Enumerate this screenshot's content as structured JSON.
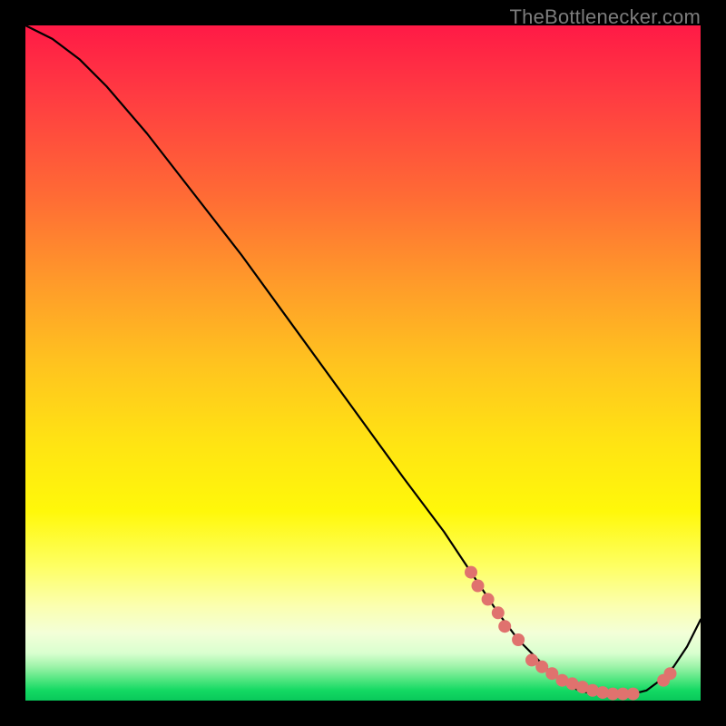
{
  "watermark": "TheBottlenecker.com",
  "colors": {
    "dot": "#e0726e",
    "line": "#000000"
  },
  "chart_data": {
    "type": "line",
    "title": "",
    "xlabel": "",
    "ylabel": "",
    "xlim": [
      0,
      100
    ],
    "ylim": [
      0,
      100
    ],
    "grid": false,
    "legend": false,
    "series": [
      {
        "name": "bottleneck-curve",
        "x": [
          0,
          4,
          8,
          12,
          18,
          25,
          32,
          40,
          48,
          56,
          62,
          66,
          70,
          73,
          76,
          78,
          80,
          82,
          84,
          86,
          88,
          90,
          92,
          94,
          96,
          98,
          100
        ],
        "values": [
          100,
          98,
          95,
          91,
          84,
          75,
          66,
          55,
          44,
          33,
          25,
          19,
          13,
          9,
          6,
          4,
          2.5,
          1.5,
          1,
          1,
          1,
          1,
          1.5,
          3,
          5,
          8,
          12
        ]
      }
    ],
    "highlight_points": {
      "name": "dotted-segment",
      "x": [
        66,
        67,
        68.5,
        70,
        71,
        73,
        75,
        76.5,
        78,
        79.5,
        81,
        82.5,
        84,
        85.5,
        87,
        88.5,
        90,
        94.5,
        95.5
      ],
      "values": [
        19,
        17,
        15,
        13,
        11,
        9,
        6,
        5,
        4,
        3,
        2.5,
        2,
        1.5,
        1.2,
        1,
        1,
        1,
        3,
        4
      ]
    }
  }
}
